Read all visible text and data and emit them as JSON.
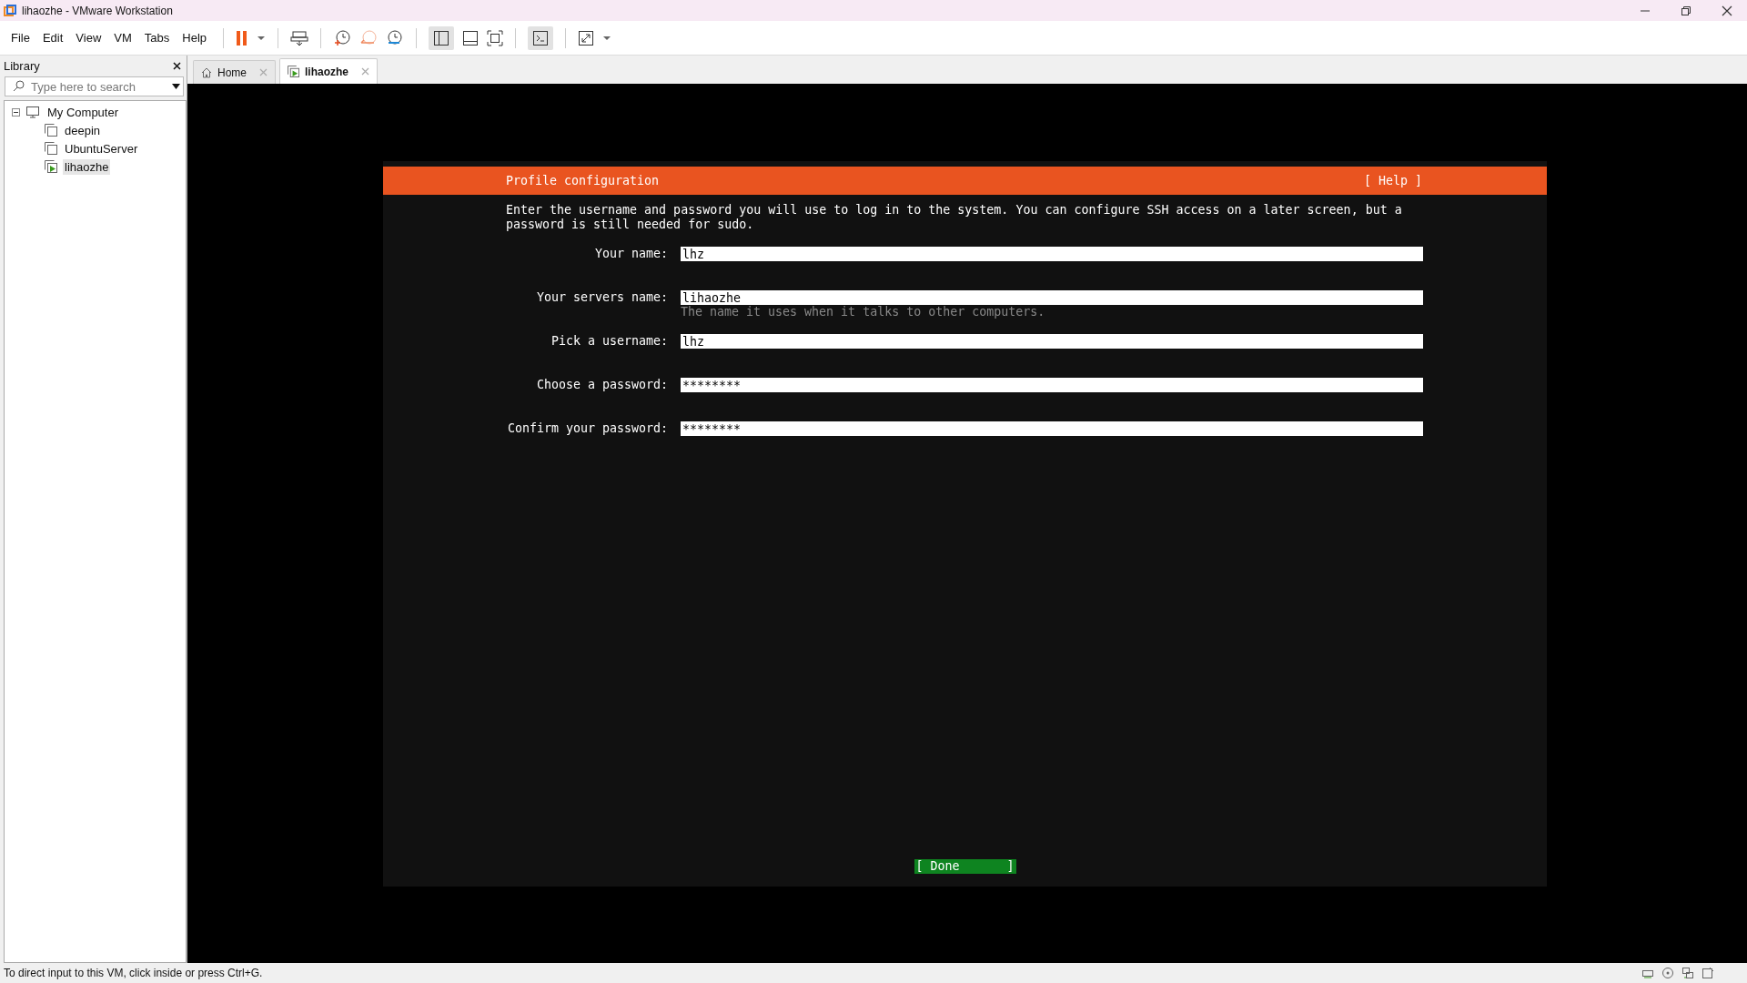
{
  "window": {
    "title": "lihaozhe - VMware Workstation"
  },
  "menu": [
    "File",
    "Edit",
    "View",
    "VM",
    "Tabs",
    "Help"
  ],
  "library": {
    "title": "Library",
    "search": {
      "placeholder": "Type here to search"
    },
    "tree": [
      {
        "label": "My Computer",
        "kind": "computer",
        "expanded": true,
        "selected": false,
        "children": [
          {
            "label": "deepin",
            "running": false,
            "selected": false
          },
          {
            "label": "UbuntuServer",
            "running": false,
            "selected": false
          },
          {
            "label": "lihaozhe",
            "running": true,
            "selected": true
          }
        ]
      }
    ]
  },
  "tabs": [
    {
      "label": "Home",
      "kind": "home",
      "selected": false
    },
    {
      "label": "lihaozhe",
      "kind": "vm",
      "selected": true
    }
  ],
  "installer": {
    "title": "Profile configuration",
    "help": "[ Help ]",
    "description": "Enter the username and password you will use to log in to the system. You can configure SSH access on a later screen, but a password is still needed for sudo.",
    "fields": [
      {
        "label": "Your name:",
        "value": "lhz"
      },
      {
        "label": "Your servers name:",
        "value": "lihaozhe",
        "hint": "The name it uses when it talks to other computers."
      },
      {
        "label": "Pick a username:",
        "value": "lhz"
      },
      {
        "label": "Choose a password:",
        "value": "********"
      },
      {
        "label": "Confirm your password:",
        "value": "********"
      }
    ],
    "done": {
      "open": "[",
      "label": "Done",
      "close": "]"
    }
  },
  "status_bar": {
    "text": "To direct input to this VM, click inside or press Ctrl+G."
  }
}
